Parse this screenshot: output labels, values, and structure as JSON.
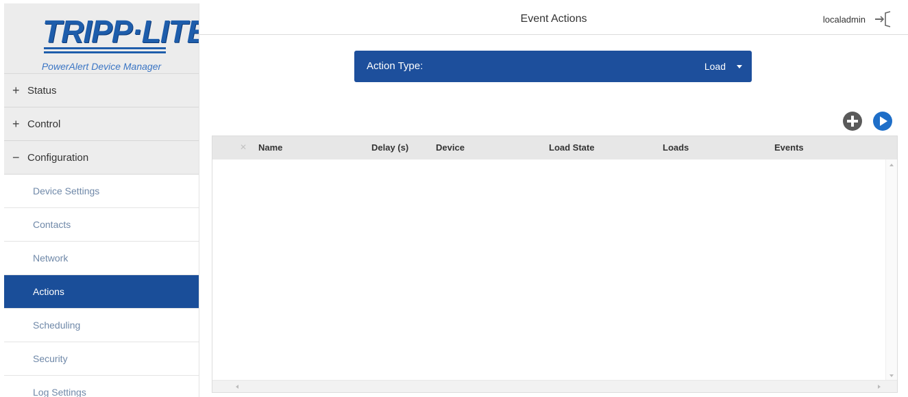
{
  "brand": {
    "logo_text": "TRIPP·LITE",
    "product_name": "PowerAlert Device Manager"
  },
  "sidebar": {
    "sections": [
      {
        "symbol": "+",
        "label": "Status"
      },
      {
        "symbol": "+",
        "label": "Control"
      },
      {
        "symbol": "−",
        "label": "Configuration"
      }
    ],
    "items": [
      {
        "label": "Device Settings"
      },
      {
        "label": "Contacts"
      },
      {
        "label": "Network"
      },
      {
        "label": "Actions",
        "active": true
      },
      {
        "label": "Scheduling"
      },
      {
        "label": "Security"
      },
      {
        "label": "Log Settings"
      }
    ]
  },
  "header": {
    "title": "Event Actions",
    "user": "localadmin"
  },
  "action_type": {
    "label": "Action Type:",
    "selected": "Load"
  },
  "table": {
    "columns": [
      "Name",
      "Delay (s)",
      "Device",
      "Load State",
      "Loads",
      "Events"
    ],
    "rows": []
  },
  "icons": {
    "add": "plus-circle-icon",
    "next": "play-circle-icon",
    "logout": "logout-icon"
  },
  "colors": {
    "brand_blue": "#1d4f9c",
    "active_nav": "#1a4e99",
    "link_gray_blue": "#6f88a8"
  }
}
